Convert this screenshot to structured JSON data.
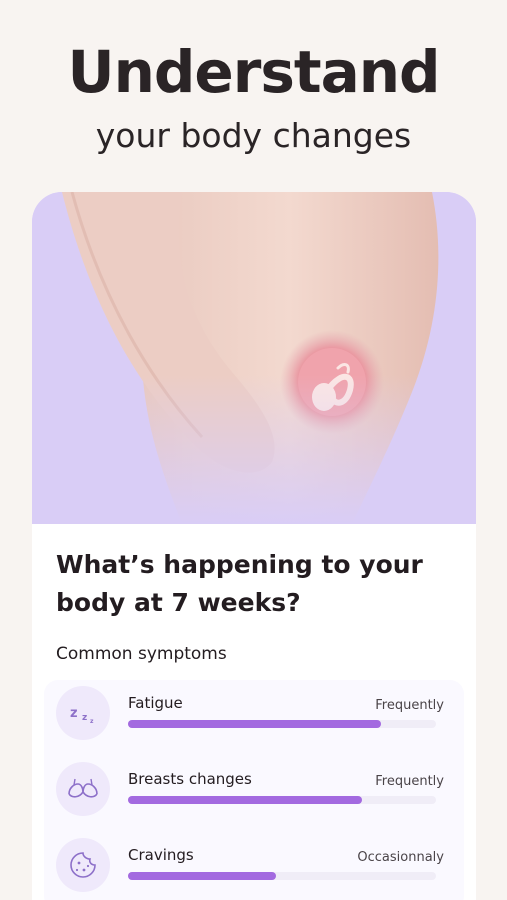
{
  "headline": "Understand",
  "subheadline": "your body changes",
  "card": {
    "title_line1": "What’s happening to your",
    "title_line2": "body at 7 weeks?",
    "section_title": "Common symptoms"
  },
  "symptoms": [
    {
      "name": "Fatigue",
      "frequency": "Frequently",
      "level": 0.82,
      "icon": "sleep-zzz-icon",
      "icon_text": "z"
    },
    {
      "name": "Breasts changes",
      "frequency": "Frequently",
      "level": 0.76,
      "icon": "bra-icon"
    },
    {
      "name": "Cravings",
      "frequency": "Occasionnaly",
      "level": 0.48,
      "icon": "cookie-icon"
    }
  ],
  "colors": {
    "background": "#f8f4f1",
    "hero_background": "#d9cdf6",
    "accent": "#a36ae0",
    "icon_circle": "#efe9fb",
    "text": "#231c20"
  }
}
